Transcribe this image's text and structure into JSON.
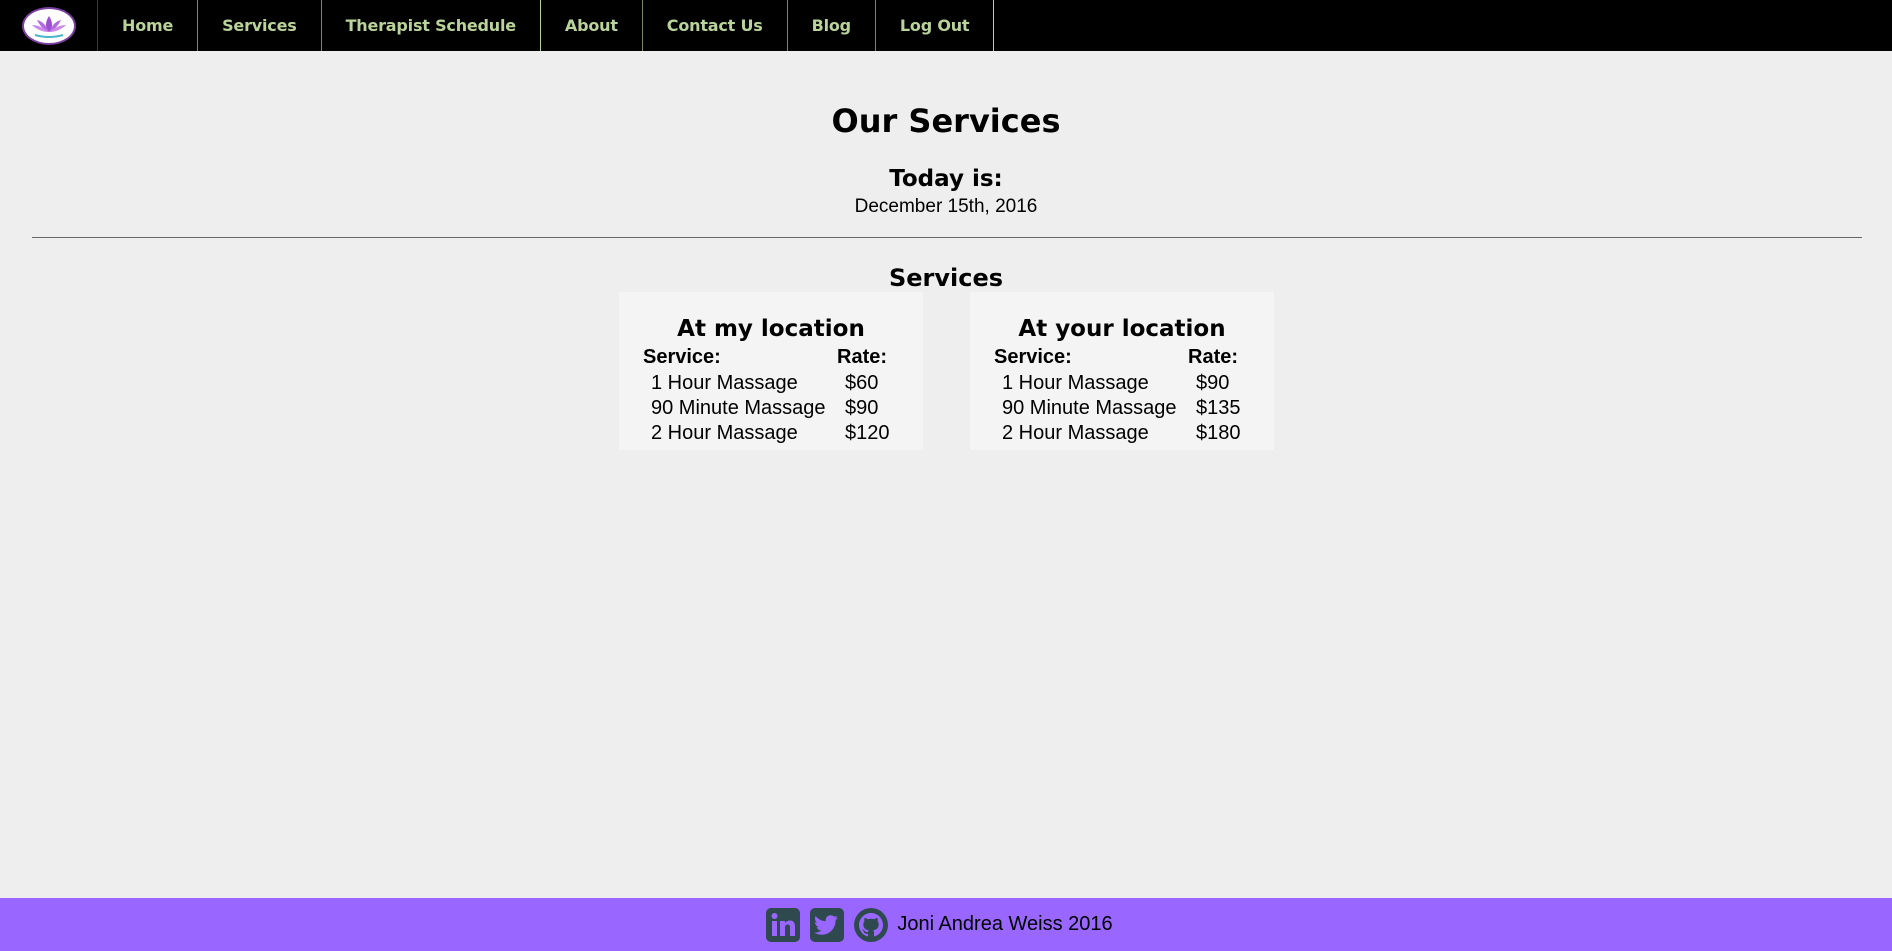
{
  "nav": {
    "items": [
      {
        "label": "Home"
      },
      {
        "label": "Services"
      },
      {
        "label": "Therapist Schedule"
      },
      {
        "label": "About"
      },
      {
        "label": "Contact Us"
      },
      {
        "label": "Blog"
      },
      {
        "label": "Log Out"
      }
    ],
    "logo_icon": "lotus-icon"
  },
  "main": {
    "title": "Our Services",
    "today_label": "Today is:",
    "today_date": "December 15th, 2016",
    "section_title": "Services",
    "cards": [
      {
        "title": "At my location",
        "headers": {
          "service": "Service:",
          "rate": "Rate:"
        },
        "rows": [
          {
            "service": "1 Hour Massage",
            "rate": "$60"
          },
          {
            "service": "90 Minute Massage",
            "rate": "$90"
          },
          {
            "service": "2 Hour Massage",
            "rate": "$120"
          }
        ]
      },
      {
        "title": "At your location",
        "headers": {
          "service": "Service:",
          "rate": "Rate:"
        },
        "rows": [
          {
            "service": "1 Hour Massage",
            "rate": "$90"
          },
          {
            "service": "90 Minute Massage",
            "rate": "$135"
          },
          {
            "service": "2 Hour Massage",
            "rate": "$180"
          }
        ]
      }
    ]
  },
  "footer": {
    "icons": [
      "linkedin-icon",
      "twitter-icon",
      "github-icon"
    ],
    "text": "Joni Andrea Weiss 2016"
  },
  "colors": {
    "nav_bg": "#000000",
    "nav_text": "#b9d39a",
    "page_bg": "#eeeeee",
    "footer_bg": "#9966ff",
    "social_icon": "#2e4a4e",
    "logo_purple": "#7a3fa0"
  }
}
